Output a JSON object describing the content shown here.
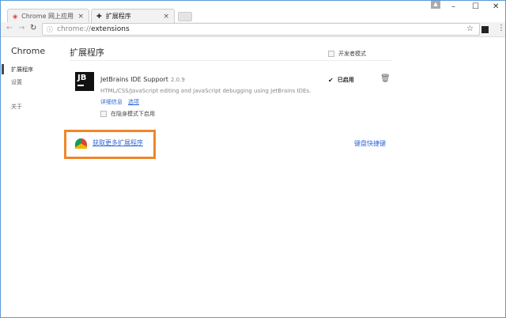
{
  "tabs": [
    {
      "label": "Chrome 网上应用店 - Je"
    },
    {
      "label": "扩展程序"
    }
  ],
  "address": {
    "scheme": "chrome://",
    "path": "extensions"
  },
  "sidebar": {
    "title": "Chrome",
    "items": [
      {
        "label": "扩展程序"
      },
      {
        "label": "设置"
      },
      {
        "label": "关于"
      }
    ]
  },
  "main": {
    "heading": "扩展程序",
    "developer_mode_label": "开发者模式",
    "extension": {
      "name": "JetBrains IDE Support",
      "version": "2.0.9",
      "description": "HTML/CSS/JavaScript editing and JavaScript debugging using JetBrains IDEs.",
      "details_link": "详细信息",
      "options_link": "选项",
      "incognito_label": "在隐身模式下启用",
      "enabled_label": "已启用",
      "icon_text": "JB"
    },
    "get_more_link": "获取更多扩展程序",
    "keyboard_shortcuts_link": "键盘快捷键"
  },
  "colors": {
    "highlight": "#f0862a",
    "link": "#3367d6"
  }
}
